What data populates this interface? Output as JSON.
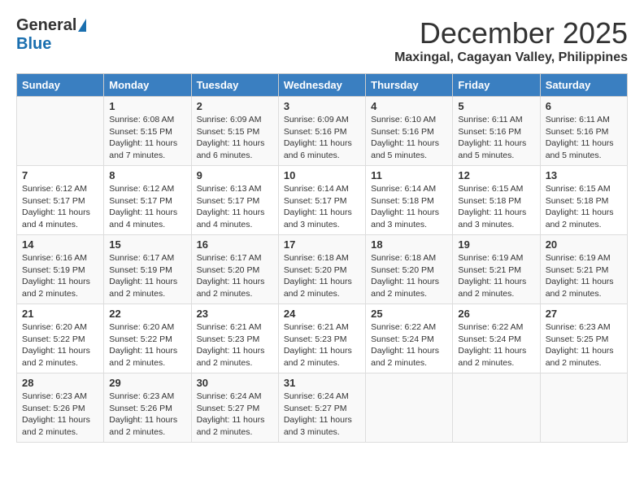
{
  "logo": {
    "general": "General",
    "blue": "Blue"
  },
  "title": "December 2025",
  "location": "Maxingal, Cagayan Valley, Philippines",
  "days_of_week": [
    "Sunday",
    "Monday",
    "Tuesday",
    "Wednesday",
    "Thursday",
    "Friday",
    "Saturday"
  ],
  "weeks": [
    [
      {
        "day": "",
        "text": ""
      },
      {
        "day": "1",
        "text": "Sunrise: 6:08 AM\nSunset: 5:15 PM\nDaylight: 11 hours\nand 7 minutes."
      },
      {
        "day": "2",
        "text": "Sunrise: 6:09 AM\nSunset: 5:15 PM\nDaylight: 11 hours\nand 6 minutes."
      },
      {
        "day": "3",
        "text": "Sunrise: 6:09 AM\nSunset: 5:16 PM\nDaylight: 11 hours\nand 6 minutes."
      },
      {
        "day": "4",
        "text": "Sunrise: 6:10 AM\nSunset: 5:16 PM\nDaylight: 11 hours\nand 5 minutes."
      },
      {
        "day": "5",
        "text": "Sunrise: 6:11 AM\nSunset: 5:16 PM\nDaylight: 11 hours\nand 5 minutes."
      },
      {
        "day": "6",
        "text": "Sunrise: 6:11 AM\nSunset: 5:16 PM\nDaylight: 11 hours\nand 5 minutes."
      }
    ],
    [
      {
        "day": "7",
        "text": "Sunrise: 6:12 AM\nSunset: 5:17 PM\nDaylight: 11 hours\nand 4 minutes."
      },
      {
        "day": "8",
        "text": "Sunrise: 6:12 AM\nSunset: 5:17 PM\nDaylight: 11 hours\nand 4 minutes."
      },
      {
        "day": "9",
        "text": "Sunrise: 6:13 AM\nSunset: 5:17 PM\nDaylight: 11 hours\nand 4 minutes."
      },
      {
        "day": "10",
        "text": "Sunrise: 6:14 AM\nSunset: 5:17 PM\nDaylight: 11 hours\nand 3 minutes."
      },
      {
        "day": "11",
        "text": "Sunrise: 6:14 AM\nSunset: 5:18 PM\nDaylight: 11 hours\nand 3 minutes."
      },
      {
        "day": "12",
        "text": "Sunrise: 6:15 AM\nSunset: 5:18 PM\nDaylight: 11 hours\nand 3 minutes."
      },
      {
        "day": "13",
        "text": "Sunrise: 6:15 AM\nSunset: 5:18 PM\nDaylight: 11 hours\nand 2 minutes."
      }
    ],
    [
      {
        "day": "14",
        "text": "Sunrise: 6:16 AM\nSunset: 5:19 PM\nDaylight: 11 hours\nand 2 minutes."
      },
      {
        "day": "15",
        "text": "Sunrise: 6:17 AM\nSunset: 5:19 PM\nDaylight: 11 hours\nand 2 minutes."
      },
      {
        "day": "16",
        "text": "Sunrise: 6:17 AM\nSunset: 5:20 PM\nDaylight: 11 hours\nand 2 minutes."
      },
      {
        "day": "17",
        "text": "Sunrise: 6:18 AM\nSunset: 5:20 PM\nDaylight: 11 hours\nand 2 minutes."
      },
      {
        "day": "18",
        "text": "Sunrise: 6:18 AM\nSunset: 5:20 PM\nDaylight: 11 hours\nand 2 minutes."
      },
      {
        "day": "19",
        "text": "Sunrise: 6:19 AM\nSunset: 5:21 PM\nDaylight: 11 hours\nand 2 minutes."
      },
      {
        "day": "20",
        "text": "Sunrise: 6:19 AM\nSunset: 5:21 PM\nDaylight: 11 hours\nand 2 minutes."
      }
    ],
    [
      {
        "day": "21",
        "text": "Sunrise: 6:20 AM\nSunset: 5:22 PM\nDaylight: 11 hours\nand 2 minutes."
      },
      {
        "day": "22",
        "text": "Sunrise: 6:20 AM\nSunset: 5:22 PM\nDaylight: 11 hours\nand 2 minutes."
      },
      {
        "day": "23",
        "text": "Sunrise: 6:21 AM\nSunset: 5:23 PM\nDaylight: 11 hours\nand 2 minutes."
      },
      {
        "day": "24",
        "text": "Sunrise: 6:21 AM\nSunset: 5:23 PM\nDaylight: 11 hours\nand 2 minutes."
      },
      {
        "day": "25",
        "text": "Sunrise: 6:22 AM\nSunset: 5:24 PM\nDaylight: 11 hours\nand 2 minutes."
      },
      {
        "day": "26",
        "text": "Sunrise: 6:22 AM\nSunset: 5:24 PM\nDaylight: 11 hours\nand 2 minutes."
      },
      {
        "day": "27",
        "text": "Sunrise: 6:23 AM\nSunset: 5:25 PM\nDaylight: 11 hours\nand 2 minutes."
      }
    ],
    [
      {
        "day": "28",
        "text": "Sunrise: 6:23 AM\nSunset: 5:26 PM\nDaylight: 11 hours\nand 2 minutes."
      },
      {
        "day": "29",
        "text": "Sunrise: 6:23 AM\nSunset: 5:26 PM\nDaylight: 11 hours\nand 2 minutes."
      },
      {
        "day": "30",
        "text": "Sunrise: 6:24 AM\nSunset: 5:27 PM\nDaylight: 11 hours\nand 2 minutes."
      },
      {
        "day": "31",
        "text": "Sunrise: 6:24 AM\nSunset: 5:27 PM\nDaylight: 11 hours\nand 3 minutes."
      },
      {
        "day": "",
        "text": ""
      },
      {
        "day": "",
        "text": ""
      },
      {
        "day": "",
        "text": ""
      }
    ]
  ]
}
